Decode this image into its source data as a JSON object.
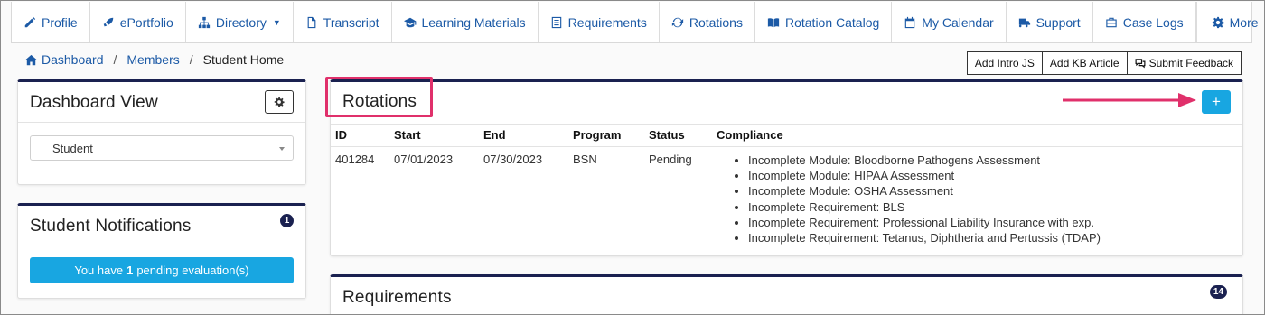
{
  "nav": {
    "items": [
      {
        "label": "Profile",
        "icon": "pencil-icon"
      },
      {
        "label": "ePortfolio",
        "icon": "rocket-icon"
      },
      {
        "label": "Directory",
        "icon": "sitemap-icon",
        "dropdown": true
      },
      {
        "label": "Transcript",
        "icon": "file-icon"
      },
      {
        "label": "Learning Materials",
        "icon": "graduation-cap-icon"
      },
      {
        "label": "Requirements",
        "icon": "list-icon"
      },
      {
        "label": "Rotations",
        "icon": "refresh-icon"
      },
      {
        "label": "Rotation Catalog",
        "icon": "book-icon"
      },
      {
        "label": "My Calendar",
        "icon": "calendar-icon"
      },
      {
        "label": "Support",
        "icon": "truck-icon"
      },
      {
        "label": "Case Logs",
        "icon": "briefcase-icon"
      }
    ],
    "more_label": "More"
  },
  "breadcrumb": {
    "home": "Dashboard",
    "members": "Members",
    "current": "Student Home"
  },
  "top_buttons": {
    "intro": "Add Intro JS",
    "kb": "Add KB Article",
    "feedback": "Submit Feedback"
  },
  "dashboard_view": {
    "title": "Dashboard View",
    "selected": "Student"
  },
  "notifications": {
    "title": "Student Notifications",
    "count": "1",
    "button_prefix": "You have",
    "button_count": "1",
    "button_suffix": "pending evaluation(s)"
  },
  "rotations": {
    "title": "Rotations",
    "add_label": "+",
    "columns": {
      "id": "ID",
      "start": "Start",
      "end": "End",
      "program": "Program",
      "status": "Status",
      "compliance": "Compliance"
    },
    "row": {
      "id": "401284",
      "start": "07/01/2023",
      "end": "07/30/2023",
      "program": "BSN",
      "status": "Pending",
      "compliance": [
        "Incomplete Module: Bloodborne Pathogens Assessment",
        "Incomplete Module: HIPAA Assessment",
        "Incomplete Module: OSHA Assessment",
        "Incomplete Requirement: BLS",
        "Incomplete Requirement: Professional Liability Insurance with exp.",
        "Incomplete Requirement: Tetanus, Diphtheria and Pertussis (TDAP)"
      ]
    }
  },
  "requirements": {
    "title": "Requirements",
    "count": "14"
  },
  "colors": {
    "brand_navy": "#1a2150",
    "link_blue": "#1c5aa6",
    "accent_cyan": "#18a6e1",
    "highlight_pink": "#e0306b"
  }
}
